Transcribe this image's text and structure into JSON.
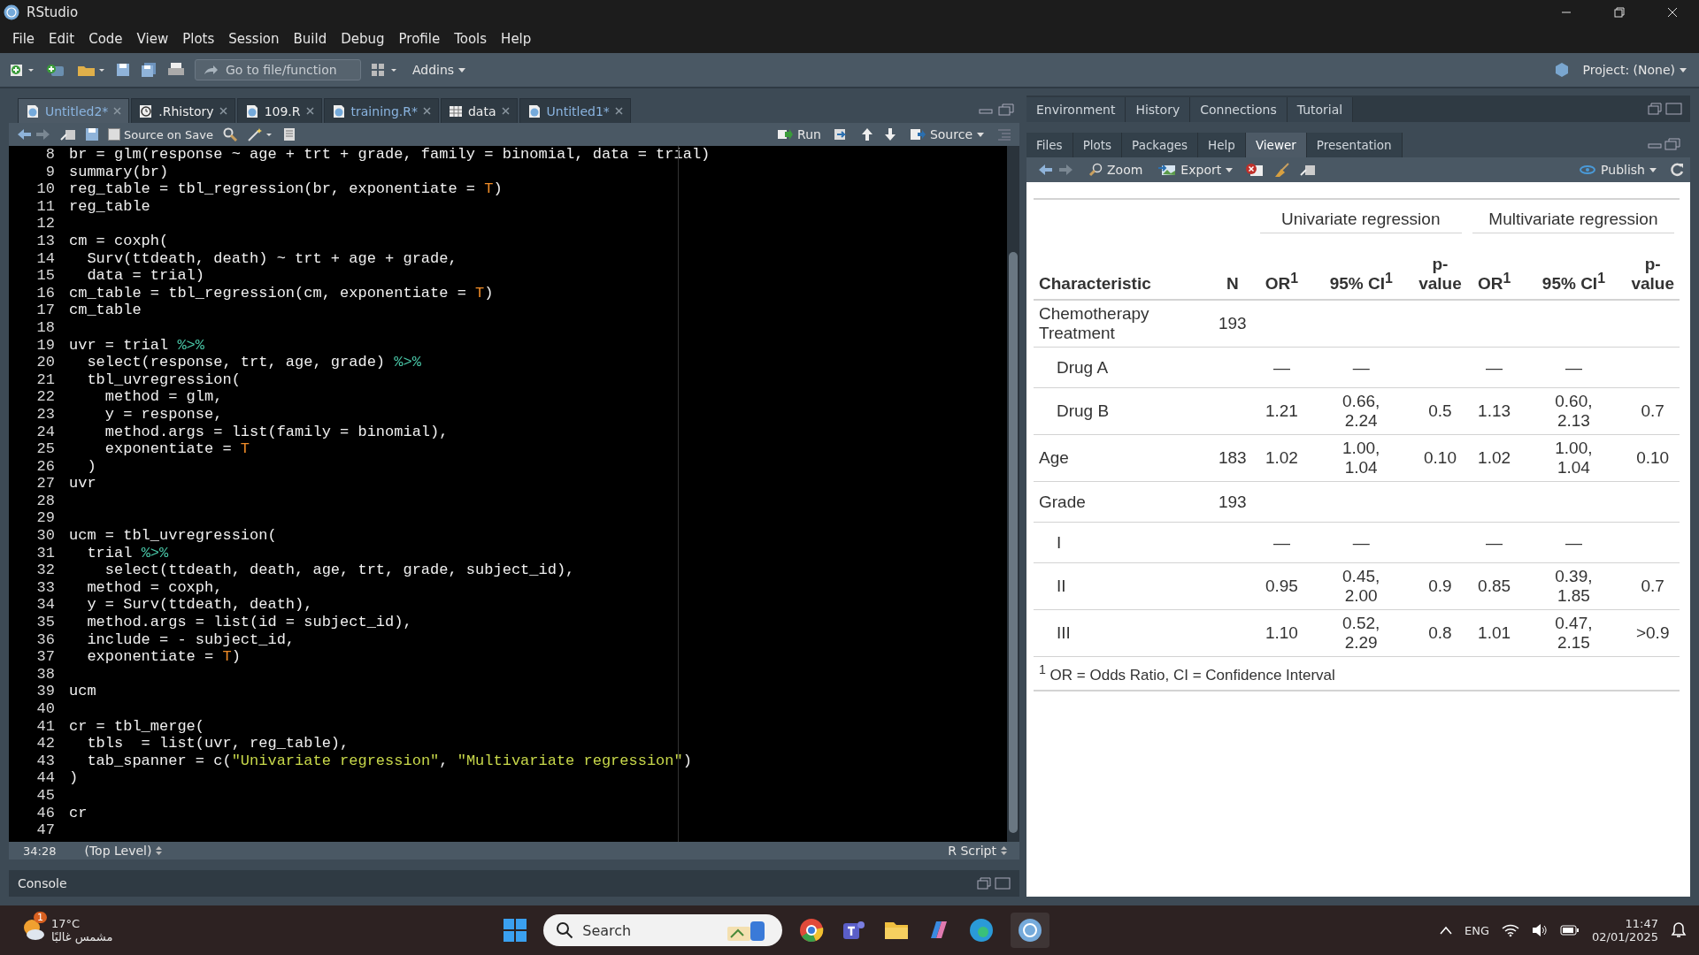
{
  "window": {
    "title": "RStudio"
  },
  "menu": [
    "File",
    "Edit",
    "Code",
    "View",
    "Plots",
    "Session",
    "Build",
    "Debug",
    "Profile",
    "Tools",
    "Help"
  ],
  "toolbar": {
    "goto_placeholder": "Go to file/function",
    "addins": "Addins",
    "project": "Project: (None)"
  },
  "editor": {
    "tabs": [
      {
        "label": "Untitled2*",
        "kind": "script",
        "selected": true,
        "modified": true
      },
      {
        "label": ".Rhistory",
        "kind": "history",
        "selected": false,
        "modified": false
      },
      {
        "label": "109.R",
        "kind": "script",
        "selected": false,
        "modified": false
      },
      {
        "label": "training.R*",
        "kind": "script",
        "selected": false,
        "modified": true
      },
      {
        "label": "data",
        "kind": "data",
        "selected": false,
        "modified": false
      },
      {
        "label": "Untitled1*",
        "kind": "script",
        "selected": false,
        "modified": true
      }
    ],
    "source_on_save": {
      "label": "Source on Save",
      "checked": false
    },
    "run": "Run",
    "source": "Source",
    "lines": [
      {
        "number": "8",
        "segments": [
          {
            "text": "br = glm(response ~ age + trt + grade, family = binomial, data = trial)",
            "kind": "plain"
          }
        ]
      },
      {
        "number": "9",
        "segments": [
          {
            "text": "summary(br)",
            "kind": "plain"
          }
        ]
      },
      {
        "number": "10",
        "segments": [
          {
            "text": "reg_table = tbl_regression(br, exponentiate = ",
            "kind": "plain"
          },
          {
            "text": "T",
            "kind": "constant"
          },
          {
            "text": ")",
            "kind": "plain"
          }
        ]
      },
      {
        "number": "11",
        "segments": [
          {
            "text": "reg_table",
            "kind": "plain"
          }
        ]
      },
      {
        "number": "12"
      },
      {
        "number": "13",
        "segments": [
          {
            "text": "cm = coxph(",
            "kind": "plain"
          }
        ]
      },
      {
        "number": "14",
        "segments": [
          {
            "text": "  Surv(ttdeath, death) ~ trt + age + grade,",
            "kind": "plain"
          }
        ]
      },
      {
        "number": "15",
        "segments": [
          {
            "text": "  data = trial)",
            "kind": "plain"
          }
        ]
      },
      {
        "number": "16",
        "segments": [
          {
            "text": "cm_table = tbl_regression(cm, exponentiate = ",
            "kind": "plain"
          },
          {
            "text": "T",
            "kind": "constant"
          },
          {
            "text": ")",
            "kind": "plain"
          }
        ]
      },
      {
        "number": "17",
        "segments": [
          {
            "text": "cm_table",
            "kind": "plain"
          }
        ]
      },
      {
        "number": "18"
      },
      {
        "number": "19",
        "segments": [
          {
            "text": "uvr = trial ",
            "kind": "plain"
          },
          {
            "text": "%>%",
            "kind": "pipe"
          }
        ]
      },
      {
        "number": "20",
        "segments": [
          {
            "text": "  select(response, trt, age, grade) ",
            "kind": "plain"
          },
          {
            "text": "%>%",
            "kind": "pipe"
          }
        ]
      },
      {
        "number": "21",
        "segments": [
          {
            "text": "  tbl_uvregression(",
            "kind": "plain"
          }
        ]
      },
      {
        "number": "22",
        "segments": [
          {
            "text": "    method = glm,",
            "kind": "plain"
          }
        ]
      },
      {
        "number": "23",
        "segments": [
          {
            "text": "    y = response,",
            "kind": "plain"
          }
        ]
      },
      {
        "number": "24",
        "segments": [
          {
            "text": "    method.args = list(family = binomial),",
            "kind": "plain"
          }
        ]
      },
      {
        "number": "25",
        "segments": [
          {
            "text": "    exponentiate = ",
            "kind": "plain"
          },
          {
            "text": "T",
            "kind": "constant"
          }
        ]
      },
      {
        "number": "26",
        "segments": [
          {
            "text": "  )",
            "kind": "plain"
          }
        ]
      },
      {
        "number": "27",
        "segments": [
          {
            "text": "uvr",
            "kind": "plain"
          }
        ]
      },
      {
        "number": "28"
      },
      {
        "number": "29"
      },
      {
        "number": "30",
        "segments": [
          {
            "text": "ucm = tbl_uvregression(",
            "kind": "plain"
          }
        ]
      },
      {
        "number": "31",
        "segments": [
          {
            "text": "  trial ",
            "kind": "plain"
          },
          {
            "text": "%>%",
            "kind": "pipe"
          }
        ]
      },
      {
        "number": "32",
        "segments": [
          {
            "text": "    select(ttdeath, death, age, trt, grade, subject_id),",
            "kind": "plain"
          }
        ]
      },
      {
        "number": "33",
        "segments": [
          {
            "text": "  method = coxph,",
            "kind": "plain"
          }
        ]
      },
      {
        "number": "34",
        "segments": [
          {
            "text": "  y = Surv(ttdeath, death),",
            "kind": "plain"
          }
        ]
      },
      {
        "number": "35",
        "segments": [
          {
            "text": "  method.args = list(id = subject_id),",
            "kind": "plain"
          }
        ]
      },
      {
        "number": "36",
        "segments": [
          {
            "text": "  include = - subject_id,",
            "kind": "plain"
          }
        ]
      },
      {
        "number": "37",
        "segments": [
          {
            "text": "  exponentiate = ",
            "kind": "plain"
          },
          {
            "text": "T",
            "kind": "constant"
          },
          {
            "text": ")",
            "kind": "plain"
          }
        ]
      },
      {
        "number": "38"
      },
      {
        "number": "39",
        "segments": [
          {
            "text": "ucm",
            "kind": "plain"
          }
        ]
      },
      {
        "number": "40"
      },
      {
        "number": "41",
        "segments": [
          {
            "text": "cr = tbl_merge(",
            "kind": "plain"
          }
        ]
      },
      {
        "number": "42",
        "segments": [
          {
            "text": "  tbls  = list(uvr, reg_table),",
            "kind": "plain"
          }
        ]
      },
      {
        "number": "43",
        "segments": [
          {
            "text": "  tab_spanner = c(",
            "kind": "plain"
          },
          {
            "text": "\"Univariate regression\"",
            "kind": "string"
          },
          {
            "text": ", ",
            "kind": "plain"
          },
          {
            "text": "\"Multivariate regression\"",
            "kind": "string"
          },
          {
            "text": ")",
            "kind": "plain"
          }
        ]
      },
      {
        "number": "44",
        "segments": [
          {
            "text": ")",
            "kind": "plain"
          }
        ]
      },
      {
        "number": "45"
      },
      {
        "number": "46",
        "segments": [
          {
            "text": "cr",
            "kind": "plain"
          }
        ]
      },
      {
        "number": "47"
      }
    ],
    "status": {
      "position": "34:28",
      "scope": "(Top Level)",
      "file_type": "R Script"
    }
  },
  "console": {
    "label": "Console"
  },
  "top_right_tabs": [
    {
      "label": "Environment",
      "selected": false
    },
    {
      "label": "History",
      "selected": false
    },
    {
      "label": "Connections",
      "selected": false
    },
    {
      "label": "Tutorial",
      "selected": false
    }
  ],
  "bottom_right_tabs": [
    {
      "label": "Files",
      "selected": false
    },
    {
      "label": "Plots",
      "selected": false
    },
    {
      "label": "Packages",
      "selected": false
    },
    {
      "label": "Help",
      "selected": false
    },
    {
      "label": "Viewer",
      "selected": true
    },
    {
      "label": "Presentation",
      "selected": false
    }
  ],
  "viewer_toolbar": {
    "zoom": "Zoom",
    "export": "Export",
    "publish": "Publish"
  },
  "table": {
    "spanners": [
      "Univariate regression",
      "Multivariate regression"
    ],
    "columns": [
      "Characteristic",
      "N",
      "OR$^{1}$",
      "95% CI$^{1}$",
      "p-value",
      "OR$^{1}$",
      "95% CI$^{1}$",
      "p-value"
    ],
    "rows": [
      {
        "cells": [
          "Chemotherapy Treatment",
          "193",
          "",
          "",
          "",
          "",
          "",
          ""
        ],
        "children": [
          {
            "cells": [
              "Drug A",
              "",
              "—",
              "—",
              "",
              "—",
              "—",
              ""
            ]
          },
          {
            "cells": [
              "Drug B",
              "",
              "1.21",
              "0.66, 2.24",
              "0.5",
              "1.13",
              "0.60, 2.13",
              "0.7"
            ]
          }
        ]
      },
      {
        "cells": [
          "Age",
          "183",
          "1.02",
          "1.00, 1.04",
          "0.10",
          "1.02",
          "1.00, 1.04",
          "0.10"
        ]
      },
      {
        "cells": [
          "Grade",
          "193",
          "",
          "",
          "",
          "",
          "",
          ""
        ],
        "children": [
          {
            "cells": [
              "I",
              "",
              "—",
              "—",
              "",
              "—",
              "—",
              ""
            ]
          },
          {
            "cells": [
              "II",
              "",
              "0.95",
              "0.45, 2.00",
              "0.9",
              "0.85",
              "0.39, 1.85",
              "0.7"
            ]
          },
          {
            "cells": [
              "III",
              "",
              "1.10",
              "0.52, 2.29",
              "0.8",
              "1.01",
              "0.47, 2.15",
              ">0.9"
            ]
          }
        ]
      }
    ],
    "footnote": "$^{1}$ OR = Odds Ratio, CI = Confidence Interval"
  },
  "taskbar": {
    "weather": {
      "temperature": "17°C",
      "condition": "مشمس غالبًا",
      "badge": "1"
    },
    "search_placeholder": "Search",
    "language": "ENG",
    "time": "11:47",
    "date": "02/01/2025"
  }
}
